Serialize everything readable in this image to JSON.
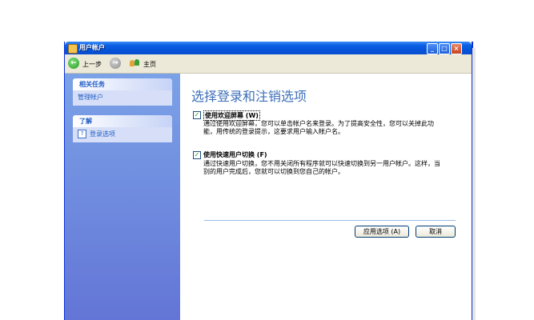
{
  "window": {
    "title": "用户帐户",
    "buttons": {
      "minimize": "_",
      "maximize": "□",
      "close": "×"
    }
  },
  "navbar": {
    "back_label": "上一步",
    "home_label": "主页",
    "icons": {
      "back": "arrow-left-icon",
      "forward": "arrow-right-icon",
      "home": "users-home-icon"
    }
  },
  "sidebar": {
    "related_tasks": {
      "header": "相关任务",
      "items": [
        "管理帐户"
      ]
    },
    "learn": {
      "header": "了解",
      "items": [
        {
          "icon": "help-icon",
          "label": "登录选项"
        }
      ]
    }
  },
  "main": {
    "title": "选择登录和注销选项",
    "options": [
      {
        "checked": true,
        "label": "使用欢迎屏幕 (W)",
        "desc_lines": [
          "通过使用欢迎屏幕，您可以单击帐户名来登录。为了提高安全性，您可以关掉此功",
          "能，用传统的登录提示，这要求用户输入帐户名。"
        ]
      },
      {
        "checked": true,
        "label": "使用快速用户切换 (F)",
        "desc_lines": [
          "通过快速用户切换，您不用关闭所有程序就可以快速切换到另一用户帐户。这样，当",
          "别的用户完成后，您就可以切换到您自己的帐户。"
        ]
      }
    ],
    "buttons": {
      "apply": "应用选项 (A)",
      "cancel": "取消"
    }
  },
  "colors": {
    "accent": "#3d6fb8",
    "titlebar": "#0553d6",
    "sidebar": "#6f8fe0"
  }
}
